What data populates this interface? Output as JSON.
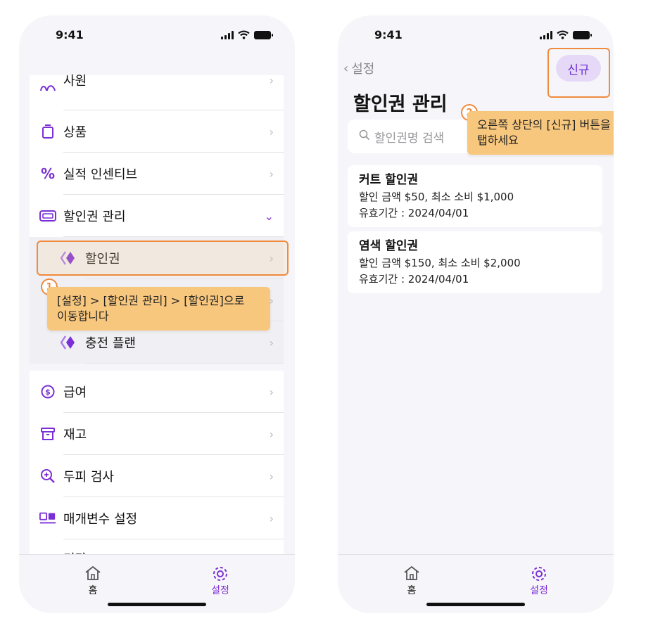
{
  "status": {
    "time": "9:41"
  },
  "left": {
    "menu_top": [
      {
        "label": "사원",
        "icon": "people-icon"
      },
      {
        "label": "상품",
        "icon": "product-icon"
      },
      {
        "label": "실적 인센티브",
        "icon": "percent-icon"
      },
      {
        "label": "할인권 관리",
        "icon": "ticket-icon"
      }
    ],
    "submenu": [
      {
        "label": "할인권",
        "icon": "coupon-icon"
      },
      {
        "label": "충전 플랜",
        "icon": "coupon-icon"
      }
    ],
    "menu_bottom": [
      {
        "label": "급여",
        "icon": "salary-icon"
      },
      {
        "label": "재고",
        "icon": "inventory-icon"
      },
      {
        "label": "두피 검사",
        "icon": "magnifier-icon"
      },
      {
        "label": "매개변수 설정",
        "icon": "parameter-icon"
      },
      {
        "label": "기타",
        "icon": "misc-icon"
      }
    ],
    "tooltip": {
      "number": "1",
      "text_line1": "[설정] > [할인권 관리] > [할인권]으로",
      "text_line2": "이동합니다"
    }
  },
  "right": {
    "back_label": "설정",
    "new_button": "신규",
    "title": "할인권 관리",
    "search_placeholder": "할인권명 검색",
    "tooltip": {
      "number": "2",
      "text_line1": "오른쪽 상단의 [신규] 버튼을",
      "text_line2": "탭하세요"
    },
    "coupons": [
      {
        "name": "커트 할인권",
        "amount": "할인 금액 $50, 최소 소비 $1,000",
        "validity": "유효기간 : 2024/04/01"
      },
      {
        "name": "염색 할인권",
        "amount": "할인 금액 $150, 최소 소비 $2,000",
        "validity": "유효기간 : 2024/04/01"
      }
    ]
  },
  "tabs": {
    "home": "홈",
    "settings": "설정"
  },
  "colors": {
    "accent": "#7b2fd6",
    "highlight": "#f08a3c",
    "tooltip": "#f8c77e"
  }
}
